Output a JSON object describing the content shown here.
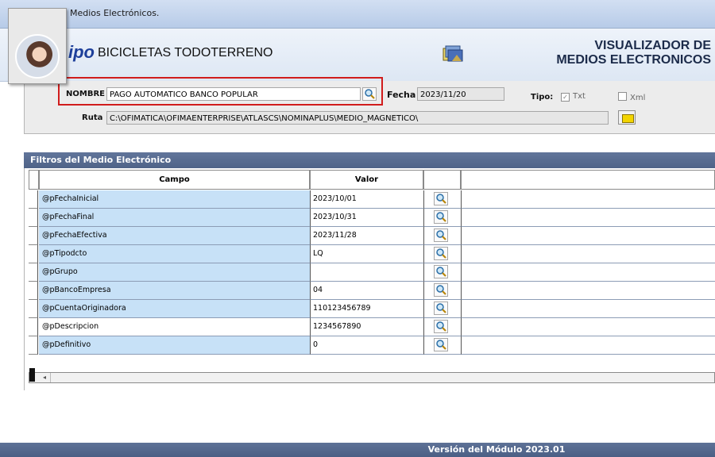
{
  "window": {
    "title": "Medios Electrónicos."
  },
  "header": {
    "logo_text": "ipo",
    "company": "BICICLETAS TODOTERRENO",
    "module_title_line1": "VISUALIZADOR DE",
    "module_title_line2": "MEDIOS ELECTRONICOS"
  },
  "form": {
    "nombre_label": "NOMBRE",
    "nombre_value": "PAGO AUTOMATICO BANCO POPULAR",
    "fecha_label": "Fecha",
    "fecha_value": "2023/11/20",
    "tipo_label": "Tipo:",
    "tipo_txt_label": "Txt",
    "tipo_txt_checked": true,
    "tipo_xml_label": "Xml",
    "tipo_xml_checked": false,
    "ruta_label": "Ruta",
    "ruta_value": "C:\\OFIMATICA\\OFIMAENTERPRISE\\ATLASCS\\NOMINAPLUS\\MEDIO_MAGNETICO\\"
  },
  "filters": {
    "title": "Filtros del  Medio Electrónico",
    "col_campo": "Campo",
    "col_valor": "Valor",
    "rows": [
      {
        "campo": "@pFechaInicial",
        "valor": "2023/10/01"
      },
      {
        "campo": "@pFechaFinal",
        "valor": "2023/10/31"
      },
      {
        "campo": "@pFechaEfectiva",
        "valor": "2023/11/28"
      },
      {
        "campo": "@pTipodcto",
        "valor": "LQ"
      },
      {
        "campo": "@pGrupo",
        "valor": ""
      },
      {
        "campo": "@pBancoEmpresa",
        "valor": "04"
      },
      {
        "campo": "@pCuentaOriginadora",
        "valor": "110123456789"
      },
      {
        "campo": "@pDescripcion",
        "valor": "1234567890"
      },
      {
        "campo": "@pDefinitivo",
        "valor": "0"
      }
    ]
  },
  "footer": {
    "version": "Versión del Módulo 2023.01"
  },
  "colors": {
    "panel_header": "#55698e",
    "campo_bg": "#c7e1f7",
    "highlight": "#d11c1c"
  }
}
